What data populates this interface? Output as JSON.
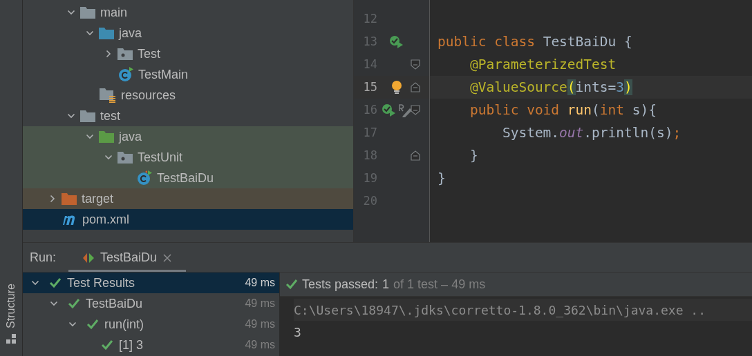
{
  "side_strip": {
    "label": "Structure"
  },
  "project_tree": {
    "nested_items": [
      {
        "label": "main",
        "kind": "folder",
        "expanded": true,
        "children": [
          {
            "label": "java",
            "kind": "source",
            "expanded": true,
            "children": [
              {
                "label": "Test",
                "kind": "package",
                "expanded": false
              },
              {
                "label": "TestMain",
                "kind": "class"
              }
            ]
          },
          {
            "label": "resources",
            "kind": "resources"
          }
        ]
      },
      {
        "label": "test",
        "kind": "folder",
        "expanded": true,
        "children": [
          {
            "label": "java",
            "kind": "test-source",
            "expanded": true,
            "children": [
              {
                "label": "TestUnit",
                "kind": "package",
                "expanded": true,
                "children": [
                  {
                    "label": "TestBaiDu",
                    "kind": "test-class"
                  }
                ]
              }
            ]
          }
        ]
      }
    ],
    "items": [
      {
        "label": "target",
        "kind": "excluded",
        "expanded": false,
        "selected": false
      },
      {
        "label": "pom.xml",
        "kind": "maven",
        "selected": true
      }
    ]
  },
  "editor": {
    "lines": [
      {
        "number": "12",
        "current": false
      },
      {
        "number": "13",
        "current": false,
        "gutter": {
          "kind": "run"
        },
        "tokens": [
          {
            "text": "public ",
            "kind": "keyword"
          },
          {
            "text": "class ",
            "kind": "keyword"
          },
          {
            "text": "TestBaiDu {",
            "kind": "plain"
          }
        ]
      },
      {
        "number": "14",
        "current": false,
        "fold": {
          "kind": "start"
        },
        "tokens": [
          {
            "text": "    @ParameterizedTest",
            "kind": "annotation"
          }
        ]
      },
      {
        "number": "15",
        "current": true,
        "fold": {
          "kind": "end"
        },
        "gutter": {
          "kind": "bulb"
        },
        "tokens": [
          {
            "text": "    @ValueSource",
            "kind": "annotation"
          },
          {
            "text": "(",
            "kind": "brace-match"
          },
          {
            "text": "ints=",
            "kind": "plain"
          },
          {
            "text": "3",
            "kind": "number"
          },
          {
            "text": ")",
            "kind": "brace-match"
          }
        ]
      },
      {
        "number": "16",
        "current": false,
        "fold": {
          "kind": "start"
        },
        "gutter": {
          "kind": "run-edit"
        },
        "tokens": [
          {
            "text": "    public ",
            "kind": "keyword"
          },
          {
            "text": "void ",
            "kind": "keyword"
          },
          {
            "text": "run",
            "kind": "method"
          },
          {
            "text": "(",
            "kind": "plain"
          },
          {
            "text": "int ",
            "kind": "keyword"
          },
          {
            "text": "s){",
            "kind": "plain"
          }
        ]
      },
      {
        "number": "17",
        "current": false,
        "tokens": [
          {
            "text": "        System.",
            "kind": "plain"
          },
          {
            "text": "out",
            "kind": "static"
          },
          {
            "text": ".println(s)",
            "kind": "plain"
          },
          {
            "text": ";",
            "kind": "keyword"
          }
        ]
      },
      {
        "number": "18",
        "current": false,
        "fold": {
          "kind": "end"
        },
        "tokens": [
          {
            "text": "    }",
            "kind": "plain"
          }
        ]
      },
      {
        "number": "19",
        "current": false,
        "tokens": [
          {
            "text": "}",
            "kind": "plain"
          }
        ]
      },
      {
        "number": "20",
        "current": false
      }
    ]
  },
  "run_panel": {
    "label": "Run:",
    "tabs": [
      {
        "label": "TestBaiDu",
        "selected": true
      }
    ],
    "results": [
      {
        "label": "Test Results",
        "time": "49 ms",
        "passed": true,
        "selected": true,
        "expanded": true,
        "children": [
          {
            "label": "TestBaiDu",
            "time": "49 ms",
            "passed": true,
            "selected": false,
            "expanded": true,
            "children": [
              {
                "label": "run(int)",
                "time": "49 ms",
                "passed": true,
                "selected": false,
                "expanded": true,
                "children": [
                  {
                    "label": "[1] 3",
                    "time": "49 ms",
                    "passed": true,
                    "selected": false
                  }
                ]
              }
            ]
          }
        ]
      }
    ],
    "status": {
      "passed": true,
      "label": "Tests passed:",
      "count": "1",
      "detail": "of 1 test – 49 ms"
    },
    "console": [
      {
        "text": "C:\\Users\\18947\\.jdks\\corretto-1.8.0_362\\bin\\java.exe ..",
        "kind": "command"
      },
      {
        "text": "3",
        "kind": "output"
      }
    ]
  }
}
